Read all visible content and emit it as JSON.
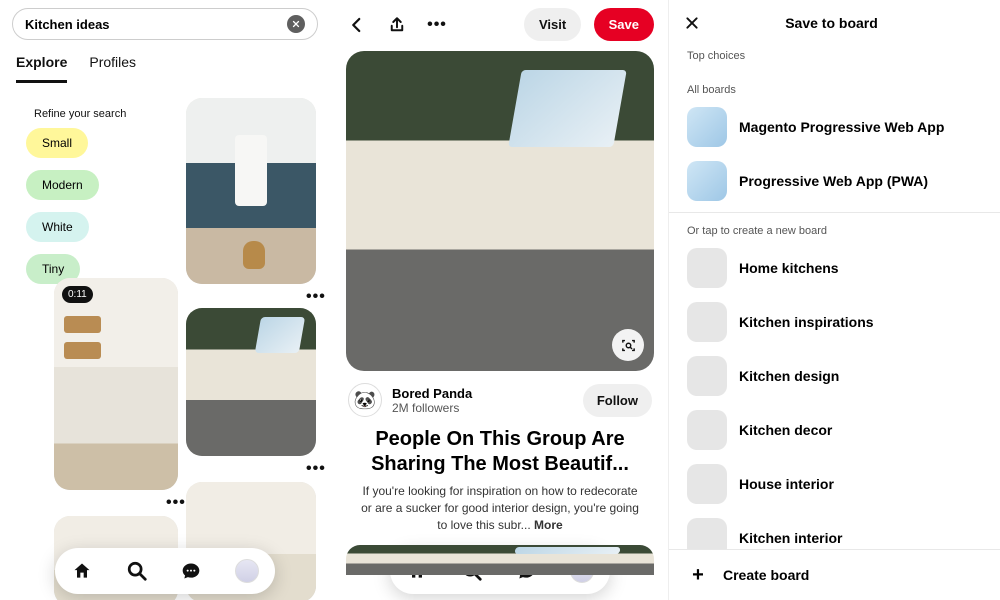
{
  "panel1": {
    "search": {
      "value": "Kitchen ideas",
      "clear_icon": "close"
    },
    "tabs": {
      "explore": "Explore",
      "profiles": "Profiles"
    },
    "refine": {
      "title": "Refine your search",
      "chips": [
        "Small",
        "Modern",
        "White",
        "Tiny"
      ]
    },
    "video_badge": "0:11"
  },
  "panel2": {
    "buttons": {
      "visit": "Visit",
      "save": "Save"
    },
    "author": {
      "name": "Bored Panda",
      "followers": "2M followers",
      "follow": "Follow",
      "emoji": "🐼"
    },
    "pin": {
      "title": "People On This Group Are Sharing The Most Beautif...",
      "desc": "If you're looking for inspiration on how to redecorate or are a sucker for good interior design, you're going to love this subr... ",
      "more": "More"
    }
  },
  "panel3": {
    "title": "Save to board",
    "top_choices_label": "Top choices",
    "all_boards_label": "All boards",
    "all_boards": [
      "Magento Progressive Web App",
      "Progressive Web App (PWA)"
    ],
    "new_board_label": "Or tap to create a new board",
    "suggested": [
      "Home kitchens",
      "Kitchen inspirations",
      "Kitchen design",
      "Kitchen decor",
      "House interior",
      "Kitchen interior"
    ],
    "create_label": "Create board"
  }
}
